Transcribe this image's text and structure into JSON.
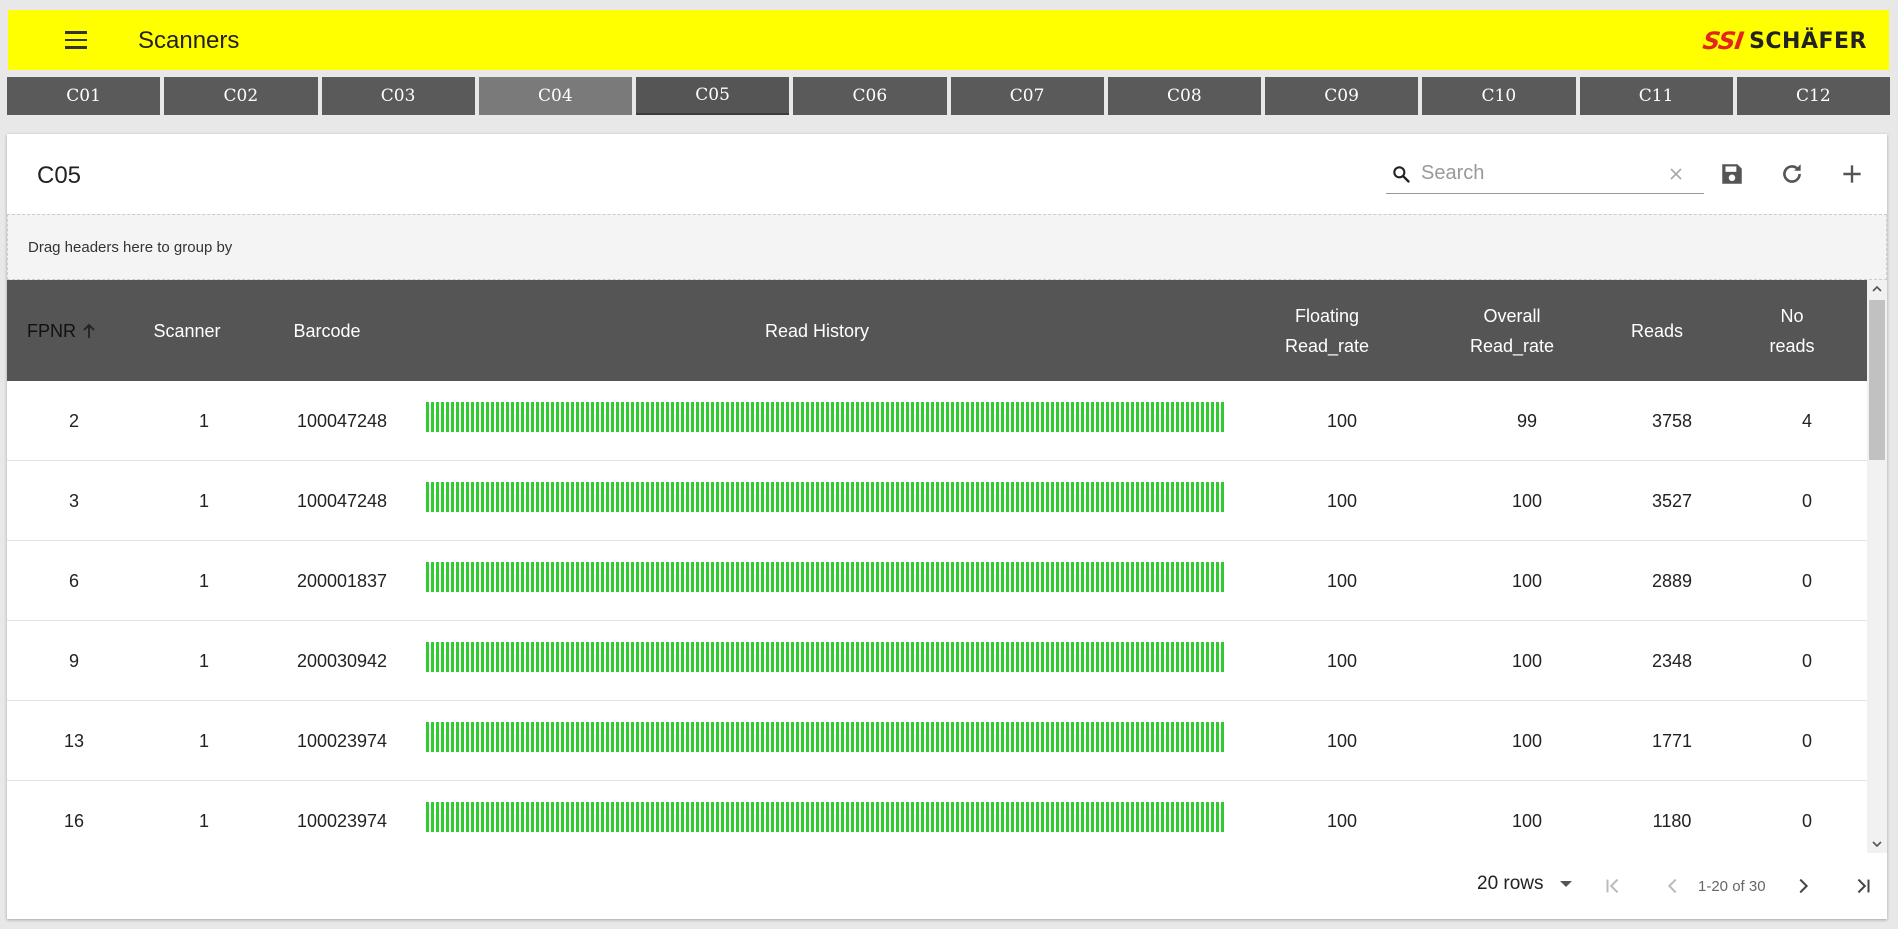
{
  "app": {
    "title": "Scanners",
    "logo_red": "SSI",
    "logo_black": "SCHÄFER",
    "colors": {
      "appbar": "#ffff00",
      "tab_bg": "#5a5a5a",
      "header_bg": "#555555",
      "bar_green": "#2ecc2e",
      "logo_red": "#e1261c"
    }
  },
  "tabs": [
    "C01",
    "C02",
    "C03",
    "C04",
    "C05",
    "C06",
    "C07",
    "C08",
    "C09",
    "C10",
    "C11",
    "C12"
  ],
  "active_tab": "C05",
  "card": {
    "title": "C05",
    "search_placeholder": "Search",
    "tool_icons": [
      "save-icon",
      "refresh-icon",
      "add-icon"
    ],
    "group_hint": "Drag headers here to group by"
  },
  "table": {
    "columns": {
      "fpnr": "FPNR",
      "scanner": "Scanner",
      "barcode": "Barcode",
      "read_history": "Read History",
      "floating_l1": "Floating",
      "floating_l2": "Read_rate",
      "overall_l1": "Overall",
      "overall_l2": "Read_rate",
      "reads": "Reads",
      "noreads_l1": "No",
      "noreads_l2": "reads"
    },
    "sort": {
      "column": "FPNR",
      "direction": "ascending"
    },
    "rows": [
      {
        "fpnr": "2",
        "scanner": "1",
        "barcode": "100047248",
        "floating": "100",
        "overall": "99",
        "reads": "3758",
        "noreads": "4"
      },
      {
        "fpnr": "3",
        "scanner": "1",
        "barcode": "100047248",
        "floating": "100",
        "overall": "100",
        "reads": "3527",
        "noreads": "0"
      },
      {
        "fpnr": "6",
        "scanner": "1",
        "barcode": "200001837",
        "floating": "100",
        "overall": "100",
        "reads": "2889",
        "noreads": "0"
      },
      {
        "fpnr": "9",
        "scanner": "1",
        "barcode": "200030942",
        "floating": "100",
        "overall": "100",
        "reads": "2348",
        "noreads": "0"
      },
      {
        "fpnr": "13",
        "scanner": "1",
        "barcode": "100023974",
        "floating": "100",
        "overall": "100",
        "reads": "1771",
        "noreads": "0"
      },
      {
        "fpnr": "16",
        "scanner": "1",
        "barcode": "100023974",
        "floating": "100",
        "overall": "100",
        "reads": "1180",
        "noreads": "0"
      }
    ]
  },
  "pagination": {
    "rows_label": "20 rows",
    "range_label": "1-20 of 30"
  }
}
